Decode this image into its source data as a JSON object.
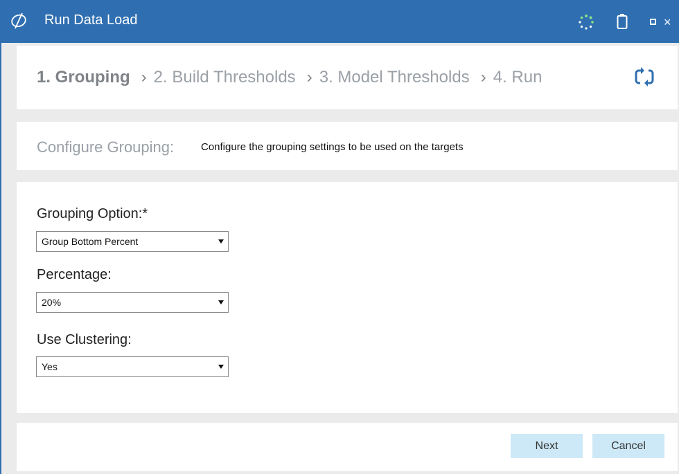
{
  "window": {
    "title": "Run Data Load",
    "accent": "#2f6fb1",
    "icons": [
      "app-logo-icon",
      "spinner-icon",
      "clipboard-icon",
      "maximize-icon",
      "close-icon"
    ],
    "close_glyph": "×"
  },
  "steps": [
    {
      "label": "1. Grouping",
      "active": true
    },
    {
      "label": "2. Build Thresholds",
      "active": false
    },
    {
      "label": "3. Model Thresholds",
      "active": false
    },
    {
      "label": "4. Run",
      "active": false
    }
  ],
  "step_separator": "›",
  "configure": {
    "label": "Configure Grouping:",
    "description": "Configure the grouping settings to be used on the targets"
  },
  "form": {
    "grouping_option": {
      "label": "Grouping Option:*",
      "value": "Group Bottom Percent"
    },
    "percentage": {
      "label": "Percentage:",
      "value": "20%"
    },
    "use_clustering": {
      "label": "Use Clustering:",
      "value": "Yes"
    }
  },
  "buttons": {
    "next": "Next",
    "cancel": "Cancel",
    "color": "#cde9f7"
  }
}
